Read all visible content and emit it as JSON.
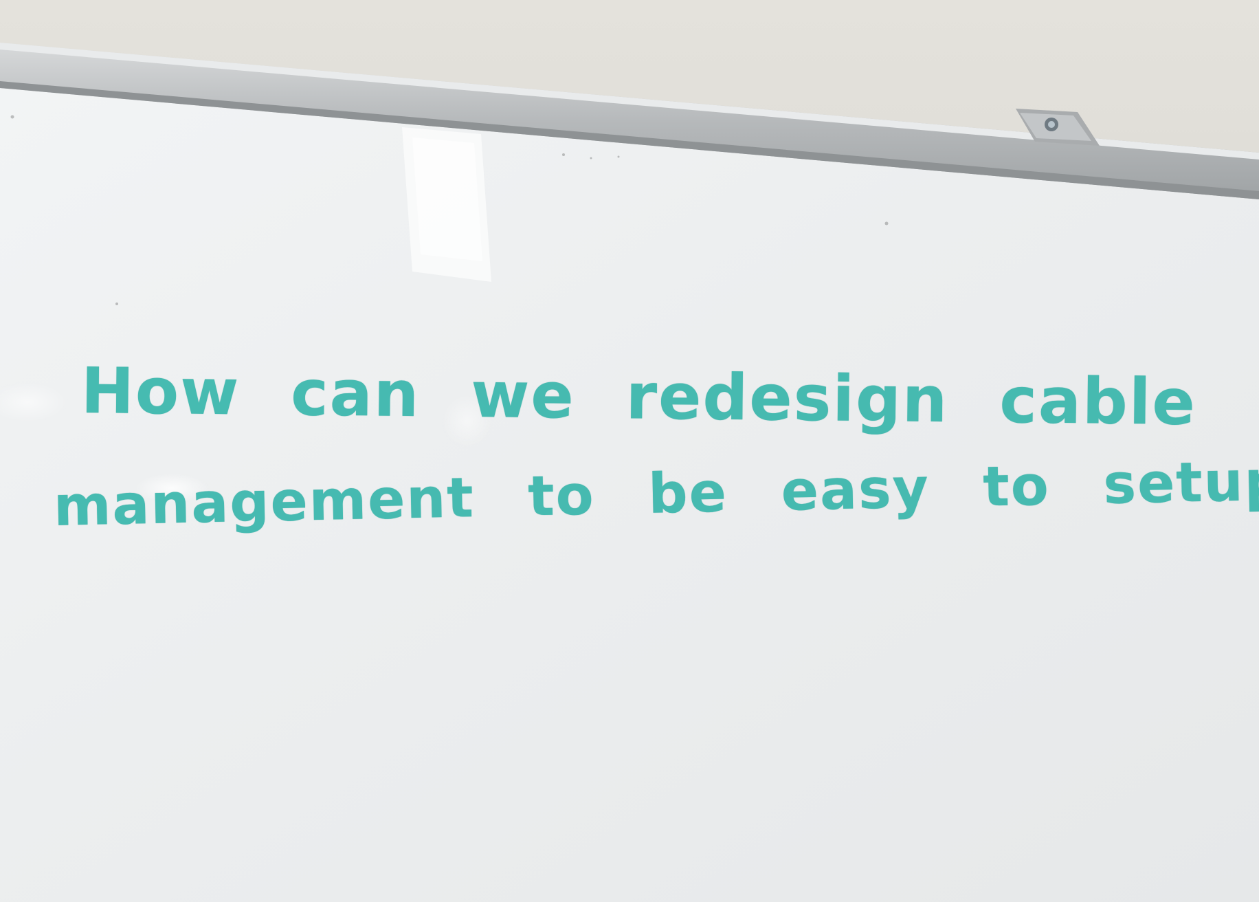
{
  "whiteboard": {
    "lines": [
      "How can we redesign cable",
      "management to be easy to setup?"
    ]
  },
  "colors": {
    "marker": "#2fb3a8",
    "board": "#eef0f1",
    "frame": "#b9bcbe",
    "wall": "#e1dfd9"
  },
  "icons": {
    "mounting_clip": "mounting-clip-icon"
  }
}
